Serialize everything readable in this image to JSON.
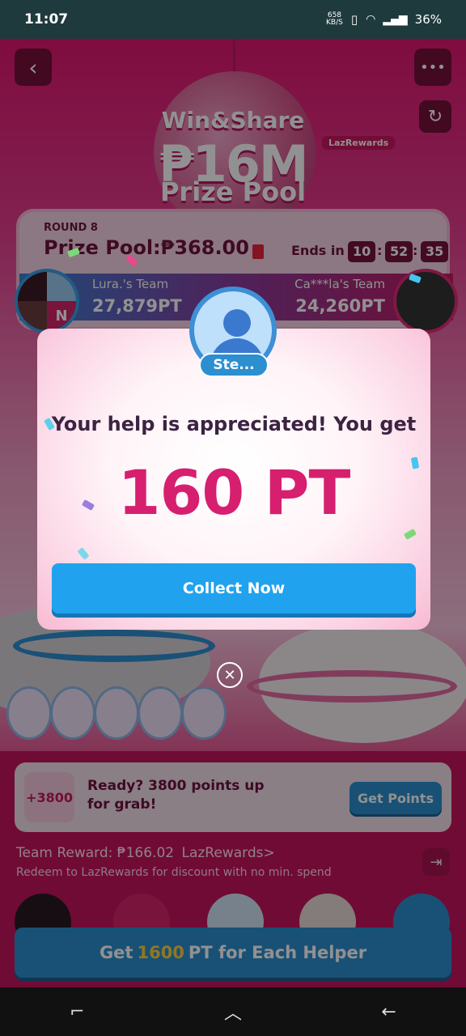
{
  "status_bar": {
    "time": "11:07",
    "net_speed": "658",
    "net_unit": "KB/S",
    "battery": "36%"
  },
  "hero": {
    "title_a": "Win&Share",
    "title_b": "₱16M",
    "title_c": "Prize Pool",
    "tag": "LazRewards"
  },
  "round": {
    "label": "ROUND 8",
    "prize_pool": "Prize Pool:₱368.00",
    "ends_in": "Ends in",
    "hours": "10",
    "minutes": "52",
    "seconds": "35",
    "team_left": "Lura.'s Team",
    "team_right": "Ca***la's Team",
    "points_left": "27,879PT",
    "points_right": "24,260PT",
    "avatar_badge": "N"
  },
  "modal": {
    "helper_name": "Ste...",
    "message": "Your help is appreciated! You get",
    "points": "160 PT",
    "collect_label": "Collect Now"
  },
  "offer": {
    "badge": "+3800",
    "text": "Ready? 3800 points up for grab!",
    "button": "Get Points"
  },
  "team_reward": {
    "label": "Team Reward: ₱166.02",
    "link": "LazRewards>",
    "redeem_text": "Redeem to LazRewards for discount with no min. spend"
  },
  "helper_cta": {
    "prefix": "Get",
    "amount": "1600",
    "suffix": "PT for Each Helper"
  },
  "icons": {
    "back": "back-chevron-icon",
    "more": "more-dots-icon",
    "refresh": "refresh-icon",
    "close": "close-icon",
    "exit": "exit-icon"
  },
  "colors": {
    "brand_pink": "#d61f6f",
    "button_blue": "#20a2ee",
    "dark_maroon": "#70123f"
  }
}
